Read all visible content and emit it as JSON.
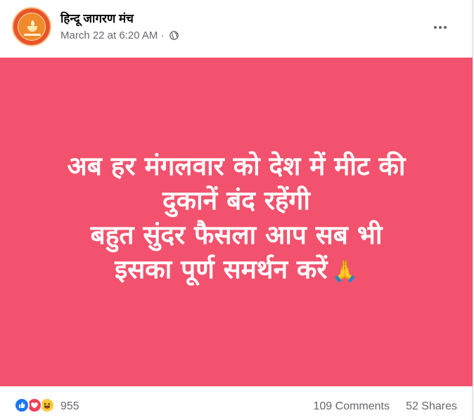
{
  "post": {
    "page_name": "हिन्दू जागरण मंच",
    "timestamp": "March 22 at 6:20 AM",
    "separator": "·",
    "privacy_icon": "globe-icon",
    "more_icon": "more-options-icon"
  },
  "banner": {
    "background": "#f2526d",
    "lines": [
      "अब हर मंगलवार को देश में मीट की",
      "दुकानें बंद रहेंगी",
      "बहुत सुंदर फैसला आप सब भी",
      "इसका पूर्ण समर्थन करें"
    ],
    "emoji": "🙏"
  },
  "footer": {
    "reaction_icons": [
      "like-icon",
      "love-icon",
      "haha-icon"
    ],
    "reaction_count": "955",
    "comments": "109 Comments",
    "shares": "52 Shares"
  }
}
